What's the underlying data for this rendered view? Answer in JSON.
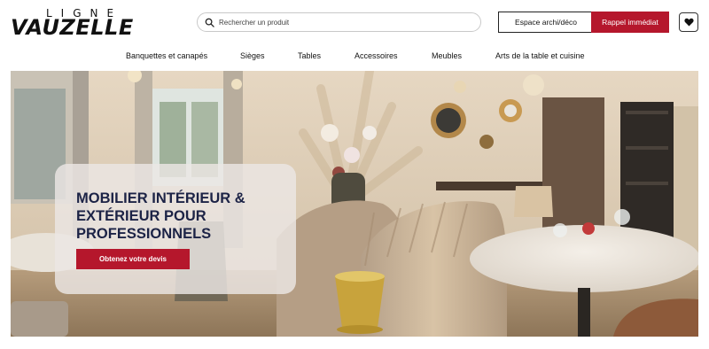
{
  "header": {
    "logo_top": "LIGNE",
    "logo_main": "VAUZELLE",
    "search_placeholder": "Rechercher un produit",
    "archi_button": "Espace archi/déco",
    "rappel_button": "Rappel immédiat",
    "favorites_icon": "heart-icon",
    "search_icon": "search-icon"
  },
  "nav": {
    "items": [
      "Banquettes et canapés",
      "Sièges",
      "Tables",
      "Accessoires",
      "Meubles",
      "Arts de la table et cuisine"
    ]
  },
  "hero": {
    "title": "MOBILIER INTÉRIEUR & EXTÉRIEUR POUR PROFESSIONNELS",
    "cta": "Obtenez votre devis"
  },
  "colors": {
    "accent": "#b5172c",
    "title": "#1c2346",
    "text": "#111111"
  }
}
